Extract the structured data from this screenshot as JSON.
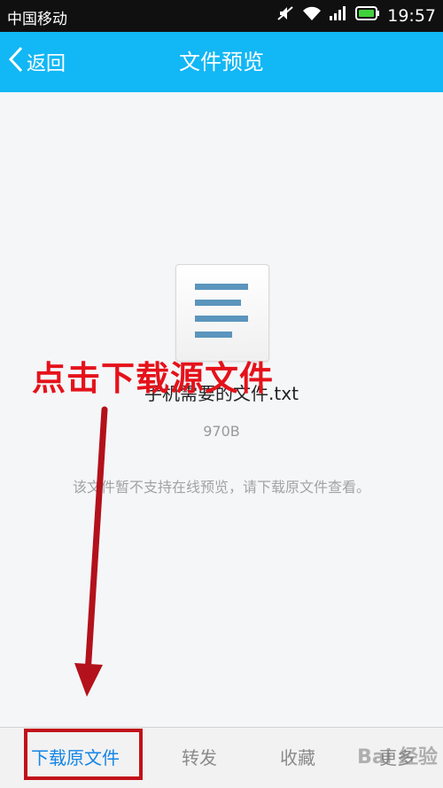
{
  "statusbar": {
    "carrier": "中国移动",
    "time": "19:57"
  },
  "navbar": {
    "back_label": "返回",
    "title": "文件预览"
  },
  "file": {
    "name": "手机需要的文件.txt",
    "size": "970B",
    "notice": "该文件暂不支持在线预览，请下载原文件查看。"
  },
  "annotation": {
    "text": "点击下载源文件",
    "color": "#e5121a"
  },
  "toolbar": {
    "download_label": "下载原文件",
    "forward_label": "转发",
    "favorite_label": "收藏",
    "more_label": "更多"
  },
  "watermark": {
    "text": "Bai 经验"
  },
  "colors": {
    "accent": "#12b7f5",
    "link": "#1585e6",
    "annotation": "#c1111a"
  }
}
